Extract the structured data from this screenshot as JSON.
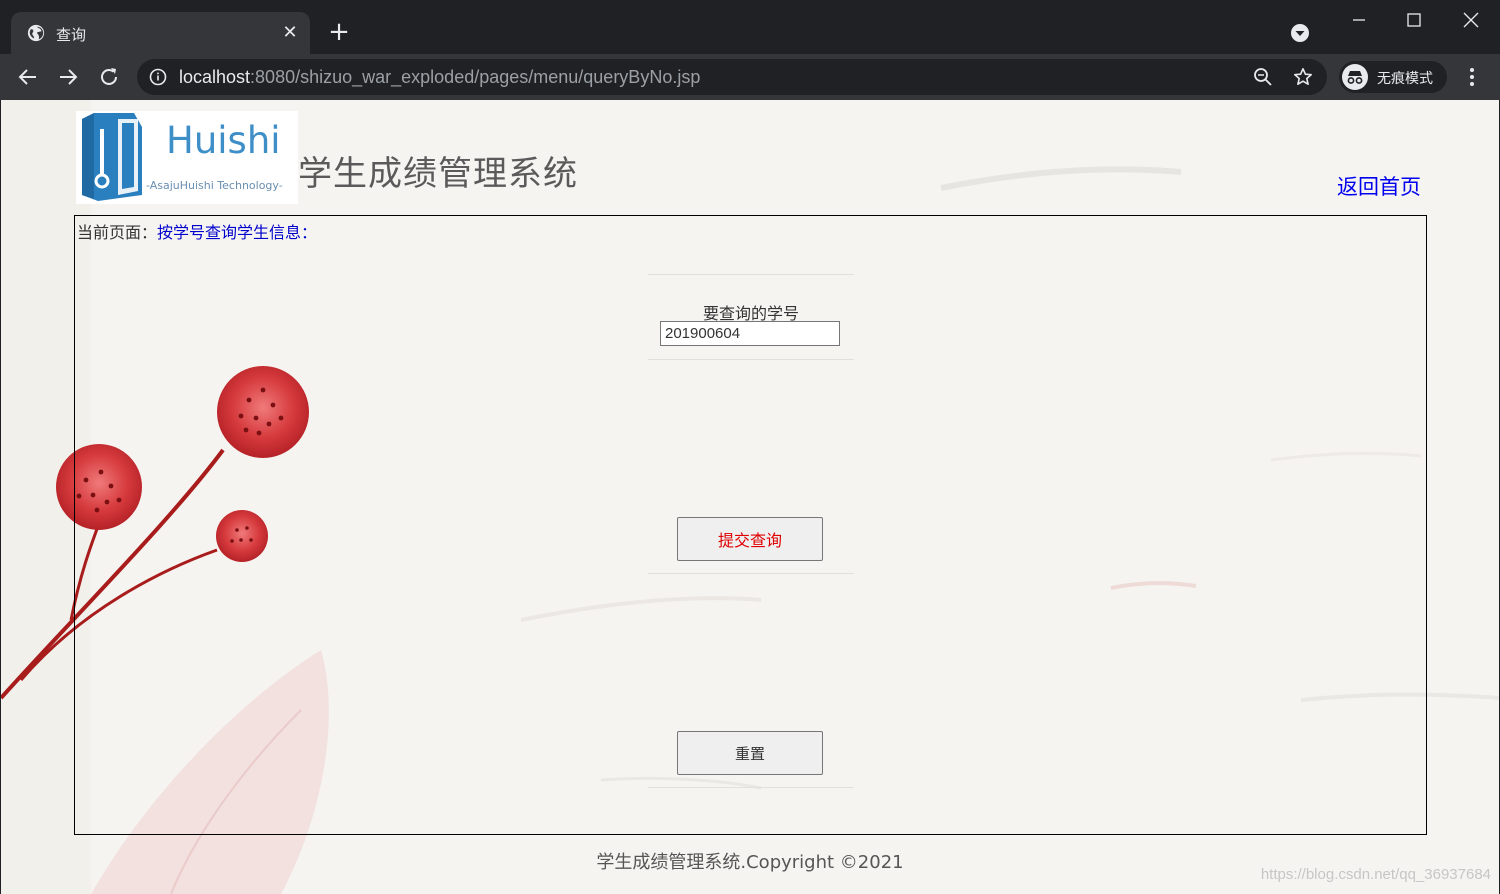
{
  "browser": {
    "tab_title": "查询",
    "url_host": "localhost",
    "url_rest": ":8080/shizuo_war_exploded/pages/menu/queryByNo.jsp",
    "incognito_label": "无痕模式",
    "icons": [
      "globe-icon",
      "close-icon",
      "plus-icon",
      "chevron-down-icon",
      "minimize-icon",
      "maximize-icon",
      "close-window-icon",
      "back-arrow-icon",
      "forward-arrow-icon",
      "reload-icon",
      "info-icon",
      "zoom-icon",
      "star-icon",
      "incognito-icon",
      "kebab-menu-icon"
    ]
  },
  "page": {
    "logo_name": "Huishi",
    "logo_tagline": "-AsajuHuishi Technology-",
    "title": "学生成绩管理系统",
    "home_link": "返回首页",
    "breadcrumb_label": "当前页面：",
    "breadcrumb_value": "按学号查询学生信息：",
    "form": {
      "field_label": "要查询的学号",
      "field_value": "201900604",
      "submit_label": "提交查询",
      "reset_label": "重置"
    },
    "footer": "学生成绩管理系统.Copyright ©2021",
    "watermark": "https://blog.csdn.net/qq_36937684"
  }
}
